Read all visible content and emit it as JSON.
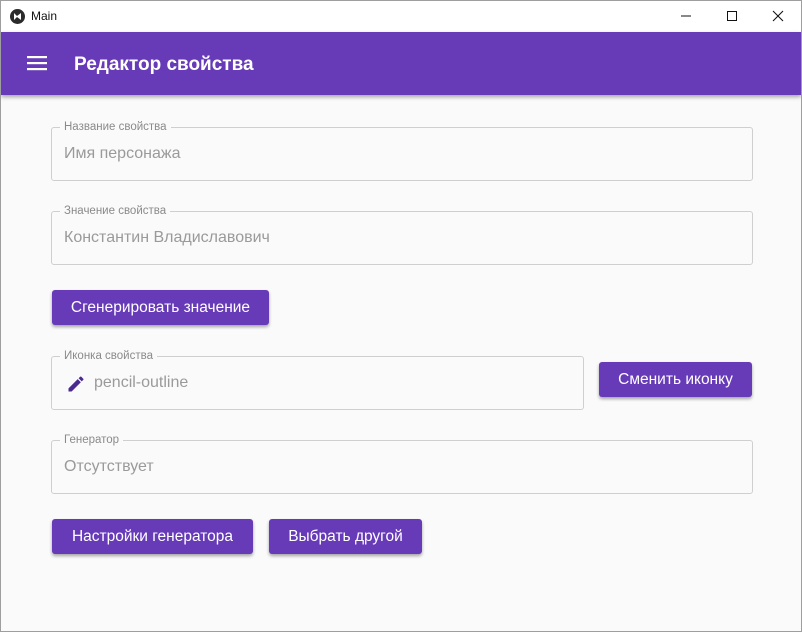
{
  "window": {
    "title": "Main"
  },
  "appbar": {
    "title": "Редактор свойства",
    "menu_icon": "menu-icon",
    "color": "#673ab7"
  },
  "form": {
    "property_name": {
      "label": "Название свойства",
      "value": "Имя персонажа"
    },
    "property_value": {
      "label": "Значение свойства",
      "value": "Константин Владиславович"
    },
    "generate_button": "Сгенерировать значение",
    "property_icon": {
      "label": "Иконка свойства",
      "value": "pencil-outline",
      "icon": "pencil-icon"
    },
    "change_icon_button": "Сменить иконку",
    "generator": {
      "label": "Генератор",
      "value": "Отсутствует"
    },
    "generator_settings_button": "Настройки генератора",
    "choose_other_button": "Выбрать другой"
  }
}
